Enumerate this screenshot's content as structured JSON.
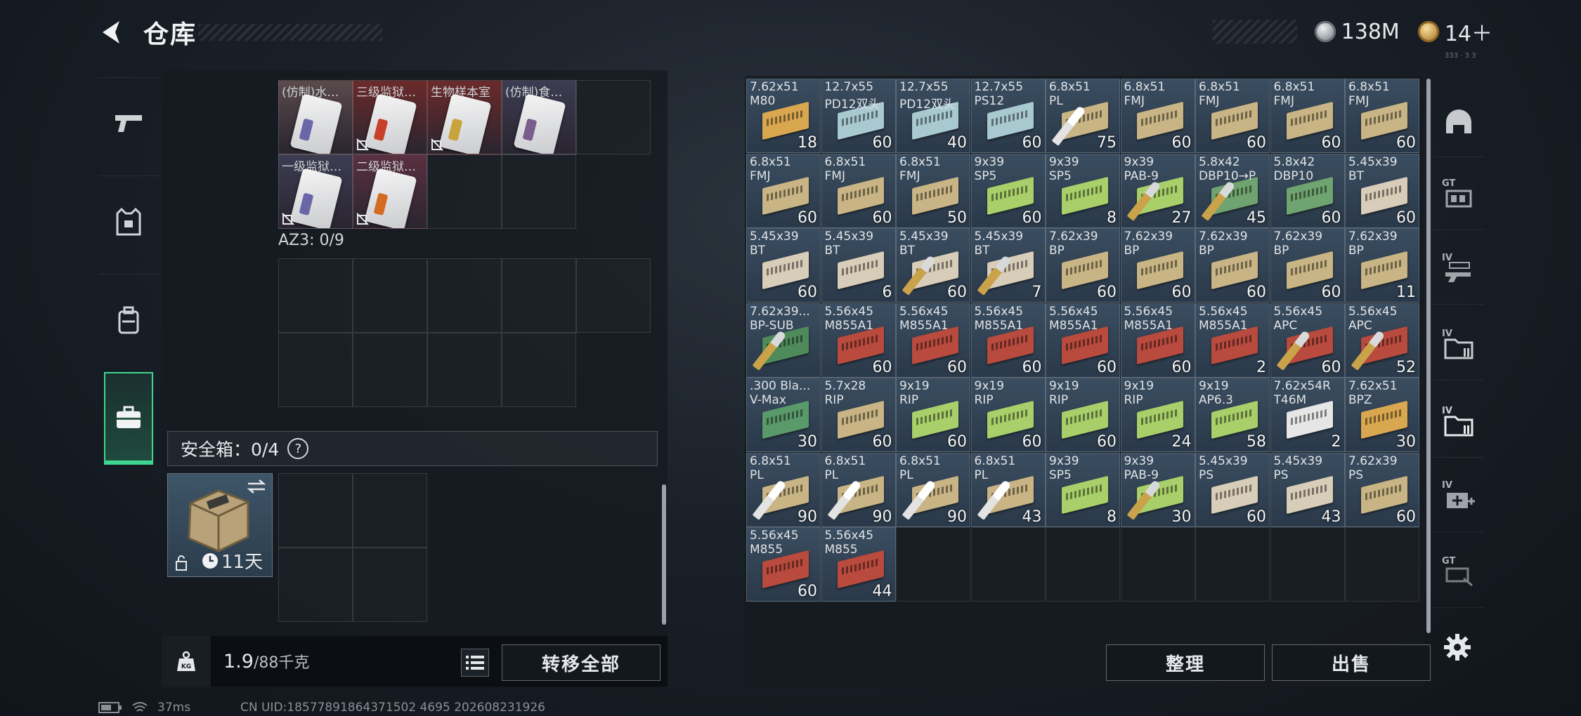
{
  "header": {
    "title": "仓库",
    "currency1": "138M",
    "currency2": "14＋",
    "currency1_icon": "silver-coin-icon",
    "currency2_icon": "gold-coin-icon",
    "corner_note": "333 · 3 3"
  },
  "left_tabs": [
    {
      "icon": "pistol-icon"
    },
    {
      "icon": "vest-icon"
    },
    {
      "icon": "backpack-icon"
    },
    {
      "icon": "briefcase-icon",
      "active": true
    }
  ],
  "container": {
    "items": [
      {
        "name": "(仿制)水…",
        "bg": "#5a4a4c",
        "stripe": "#6a66a8",
        "lock": false
      },
      {
        "name": "三级监狱…",
        "bg": "#6b2a2a",
        "stripe": "#c8402a",
        "lock": true
      },
      {
        "name": "生物样本室",
        "bg": "#6b2a2a",
        "stripe": "#c8a23a",
        "lock": true
      },
      {
        "name": "(仿制)食…",
        "bg": "#3c3c52",
        "stripe": "#7a5d8e",
        "lock": false
      },
      {
        "name": "一级监狱…",
        "bg": "#3c3c52",
        "stripe": "#6a66a8",
        "lock": true
      },
      {
        "name": "二级监狱…",
        "bg": "#5a3040",
        "stripe": "#d36b22",
        "lock": true
      }
    ],
    "az3_label": "AZ3: 0/9",
    "safebox_label": "安全箱：0/4",
    "help_label": "?",
    "safebox_days": "11天"
  },
  "weight": {
    "current": "1.9",
    "max": "/88千克"
  },
  "buttons": {
    "transfer_all": "转移全部",
    "sort": "整理",
    "sell": "出售"
  },
  "ammo": [
    {
      "cal": "7.62x51",
      "type": "M80",
      "count": "18",
      "box": "#d9a74f",
      "bullet": ""
    },
    {
      "cal": "12.7x55",
      "type": "PD12双头",
      "count": "60",
      "box": "#a8c9d0",
      "bullet": ""
    },
    {
      "cal": "12.7x55",
      "type": "PD12双头",
      "count": "40",
      "box": "#a8c9d0",
      "bullet": ""
    },
    {
      "cal": "12.7x55",
      "type": "PS12",
      "count": "60",
      "box": "#a8c9d0",
      "bullet": ""
    },
    {
      "cal": "6.8x51",
      "type": "PL",
      "count": "75",
      "box": "#c8b484",
      "bullet": "white"
    },
    {
      "cal": "6.8x51",
      "type": "FMJ",
      "count": "60",
      "box": "#c8b484",
      "bullet": ""
    },
    {
      "cal": "6.8x51",
      "type": "FMJ",
      "count": "60",
      "box": "#c8b484",
      "bullet": ""
    },
    {
      "cal": "6.8x51",
      "type": "FMJ",
      "count": "60",
      "box": "#c8b484",
      "bullet": ""
    },
    {
      "cal": "6.8x51",
      "type": "FMJ",
      "count": "60",
      "box": "#c8b484",
      "bullet": ""
    },
    {
      "cal": "6.8x51",
      "type": "FMJ",
      "count": "60",
      "box": "#c8b484",
      "bullet": ""
    },
    {
      "cal": "6.8x51",
      "type": "FMJ",
      "count": "60",
      "box": "#c8b484",
      "bullet": ""
    },
    {
      "cal": "6.8x51",
      "type": "FMJ",
      "count": "50",
      "box": "#c8b484",
      "bullet": ""
    },
    {
      "cal": "9x39",
      "type": "SP5",
      "count": "60",
      "box": "#a8cf6a",
      "bullet": ""
    },
    {
      "cal": "9x39",
      "type": "SP5",
      "count": "8",
      "box": "#a8cf6a",
      "bullet": ""
    },
    {
      "cal": "9x39",
      "type": "PAB-9",
      "count": "27",
      "box": "#a8cf6a",
      "bullet": "brass"
    },
    {
      "cal": "5.8x42",
      "type": "DBP10→P",
      "count": "45",
      "box": "#6fa36f",
      "bullet": "brass"
    },
    {
      "cal": "5.8x42",
      "type": "DBP10",
      "count": "60",
      "box": "#6fa36f",
      "bullet": ""
    },
    {
      "cal": "5.45x39",
      "type": "BT",
      "count": "60",
      "box": "#d8cdb8",
      "bullet": ""
    },
    {
      "cal": "5.45x39",
      "type": "BT",
      "count": "60",
      "box": "#d8cdb8",
      "bullet": ""
    },
    {
      "cal": "5.45x39",
      "type": "BT",
      "count": "6",
      "box": "#d8cdb8",
      "bullet": ""
    },
    {
      "cal": "5.45x39",
      "type": "BT",
      "count": "60",
      "box": "#d8cdb8",
      "bullet": "brass"
    },
    {
      "cal": "5.45x39",
      "type": "BT",
      "count": "7",
      "box": "#d8cdb8",
      "bullet": "brass"
    },
    {
      "cal": "7.62x39",
      "type": "BP",
      "count": "60",
      "box": "#c8b484",
      "bullet": ""
    },
    {
      "cal": "7.62x39",
      "type": "BP",
      "count": "60",
      "box": "#c8b484",
      "bullet": ""
    },
    {
      "cal": "7.62x39",
      "type": "BP",
      "count": "60",
      "box": "#c8b484",
      "bullet": ""
    },
    {
      "cal": "7.62x39",
      "type": "BP",
      "count": "60",
      "box": "#c8b484",
      "bullet": ""
    },
    {
      "cal": "7.62x39",
      "type": "BP",
      "count": "11",
      "box": "#c8b484",
      "bullet": ""
    },
    {
      "cal": "7.62x39...",
      "type": "BP-SUB",
      "count": "",
      "box": "#4f8a5a",
      "bullet": "brass"
    },
    {
      "cal": "5.56x45",
      "type": "M855A1",
      "count": "60",
      "box": "#b84a3e",
      "bullet": ""
    },
    {
      "cal": "5.56x45",
      "type": "M855A1",
      "count": "60",
      "box": "#b84a3e",
      "bullet": ""
    },
    {
      "cal": "5.56x45",
      "type": "M855A1",
      "count": "60",
      "box": "#b84a3e",
      "bullet": ""
    },
    {
      "cal": "5.56x45",
      "type": "M855A1",
      "count": "60",
      "box": "#b84a3e",
      "bullet": ""
    },
    {
      "cal": "5.56x45",
      "type": "M855A1",
      "count": "60",
      "box": "#b84a3e",
      "bullet": ""
    },
    {
      "cal": "5.56x45",
      "type": "M855A1",
      "count": "2",
      "box": "#b84a3e",
      "bullet": ""
    },
    {
      "cal": "5.56x45",
      "type": "APC",
      "count": "60",
      "box": "#b84a3e",
      "bullet": "brass"
    },
    {
      "cal": "5.56x45",
      "type": "APC",
      "count": "52",
      "box": "#b84a3e",
      "bullet": "brass"
    },
    {
      "cal": ".300 Bla...",
      "type": "V-Max",
      "count": "30",
      "box": "#5a9a6a",
      "bullet": ""
    },
    {
      "cal": "5.7x28",
      "type": "RIP",
      "count": "60",
      "box": "#c8b484",
      "bullet": ""
    },
    {
      "cal": "9x19",
      "type": "RIP",
      "count": "60",
      "box": "#a8cf6a",
      "bullet": ""
    },
    {
      "cal": "9x19",
      "type": "RIP",
      "count": "60",
      "box": "#a8cf6a",
      "bullet": ""
    },
    {
      "cal": "9x19",
      "type": "RIP",
      "count": "60",
      "box": "#a8cf6a",
      "bullet": ""
    },
    {
      "cal": "9x19",
      "type": "RIP",
      "count": "24",
      "box": "#a8cf6a",
      "bullet": ""
    },
    {
      "cal": "9x19",
      "type": "AP6.3",
      "count": "58",
      "box": "#a8cf6a",
      "bullet": ""
    },
    {
      "cal": "7.62x54R",
      "type": "T46M",
      "count": "2",
      "box": "#e6e6e6",
      "bullet": ""
    },
    {
      "cal": "7.62x51",
      "type": "BPZ",
      "count": "30",
      "box": "#d9a74f",
      "bullet": ""
    },
    {
      "cal": "6.8x51",
      "type": "PL",
      "count": "90",
      "box": "#c8b484",
      "bullet": "white"
    },
    {
      "cal": "6.8x51",
      "type": "PL",
      "count": "90",
      "box": "#c8b484",
      "bullet": "white"
    },
    {
      "cal": "6.8x51",
      "type": "PL",
      "count": "90",
      "box": "#c8b484",
      "bullet": "white"
    },
    {
      "cal": "6.8x51",
      "type": "PL",
      "count": "43",
      "box": "#c8b484",
      "bullet": "white"
    },
    {
      "cal": "9x39",
      "type": "SP5",
      "count": "8",
      "box": "#a8cf6a",
      "bullet": ""
    },
    {
      "cal": "9x39",
      "type": "PAB-9",
      "count": "30",
      "box": "#a8cf6a",
      "bullet": "brass"
    },
    {
      "cal": "5.45x39",
      "type": "PS",
      "count": "60",
      "box": "#d8cdb8",
      "bullet": ""
    },
    {
      "cal": "5.45x39",
      "type": "PS",
      "count": "43",
      "box": "#d8cdb8",
      "bullet": ""
    },
    {
      "cal": "7.62x39",
      "type": "PS",
      "count": "60",
      "box": "#c8b484",
      "bullet": ""
    },
    {
      "cal": "5.56x45",
      "type": "M855",
      "count": "60",
      "box": "#b84a3e",
      "bullet": ""
    },
    {
      "cal": "5.56x45",
      "type": "M855",
      "count": "44",
      "box": "#b84a3e",
      "bullet": ""
    }
  ],
  "right_tabs": [
    {
      "icon": "helmet-icon",
      "label": ""
    },
    {
      "icon": "armor-rig-icon",
      "label": "GT"
    },
    {
      "icon": "rifle-box-icon",
      "label": "IV"
    },
    {
      "icon": "ammo-folder-icon",
      "label": "IV"
    },
    {
      "icon": "ammo-folder-icon",
      "label": "IV",
      "active": true
    },
    {
      "icon": "medkit-icon",
      "label": "IV"
    },
    {
      "icon": "tool-icon",
      "label": "GT"
    }
  ],
  "status": {
    "ping": "37ms",
    "uid": "CN UID:18577891864371502 4695 202608231926"
  },
  "colors": {
    "accent_green": "#3fd78f",
    "panel": "#161b21",
    "text": "#e6e9ec"
  }
}
